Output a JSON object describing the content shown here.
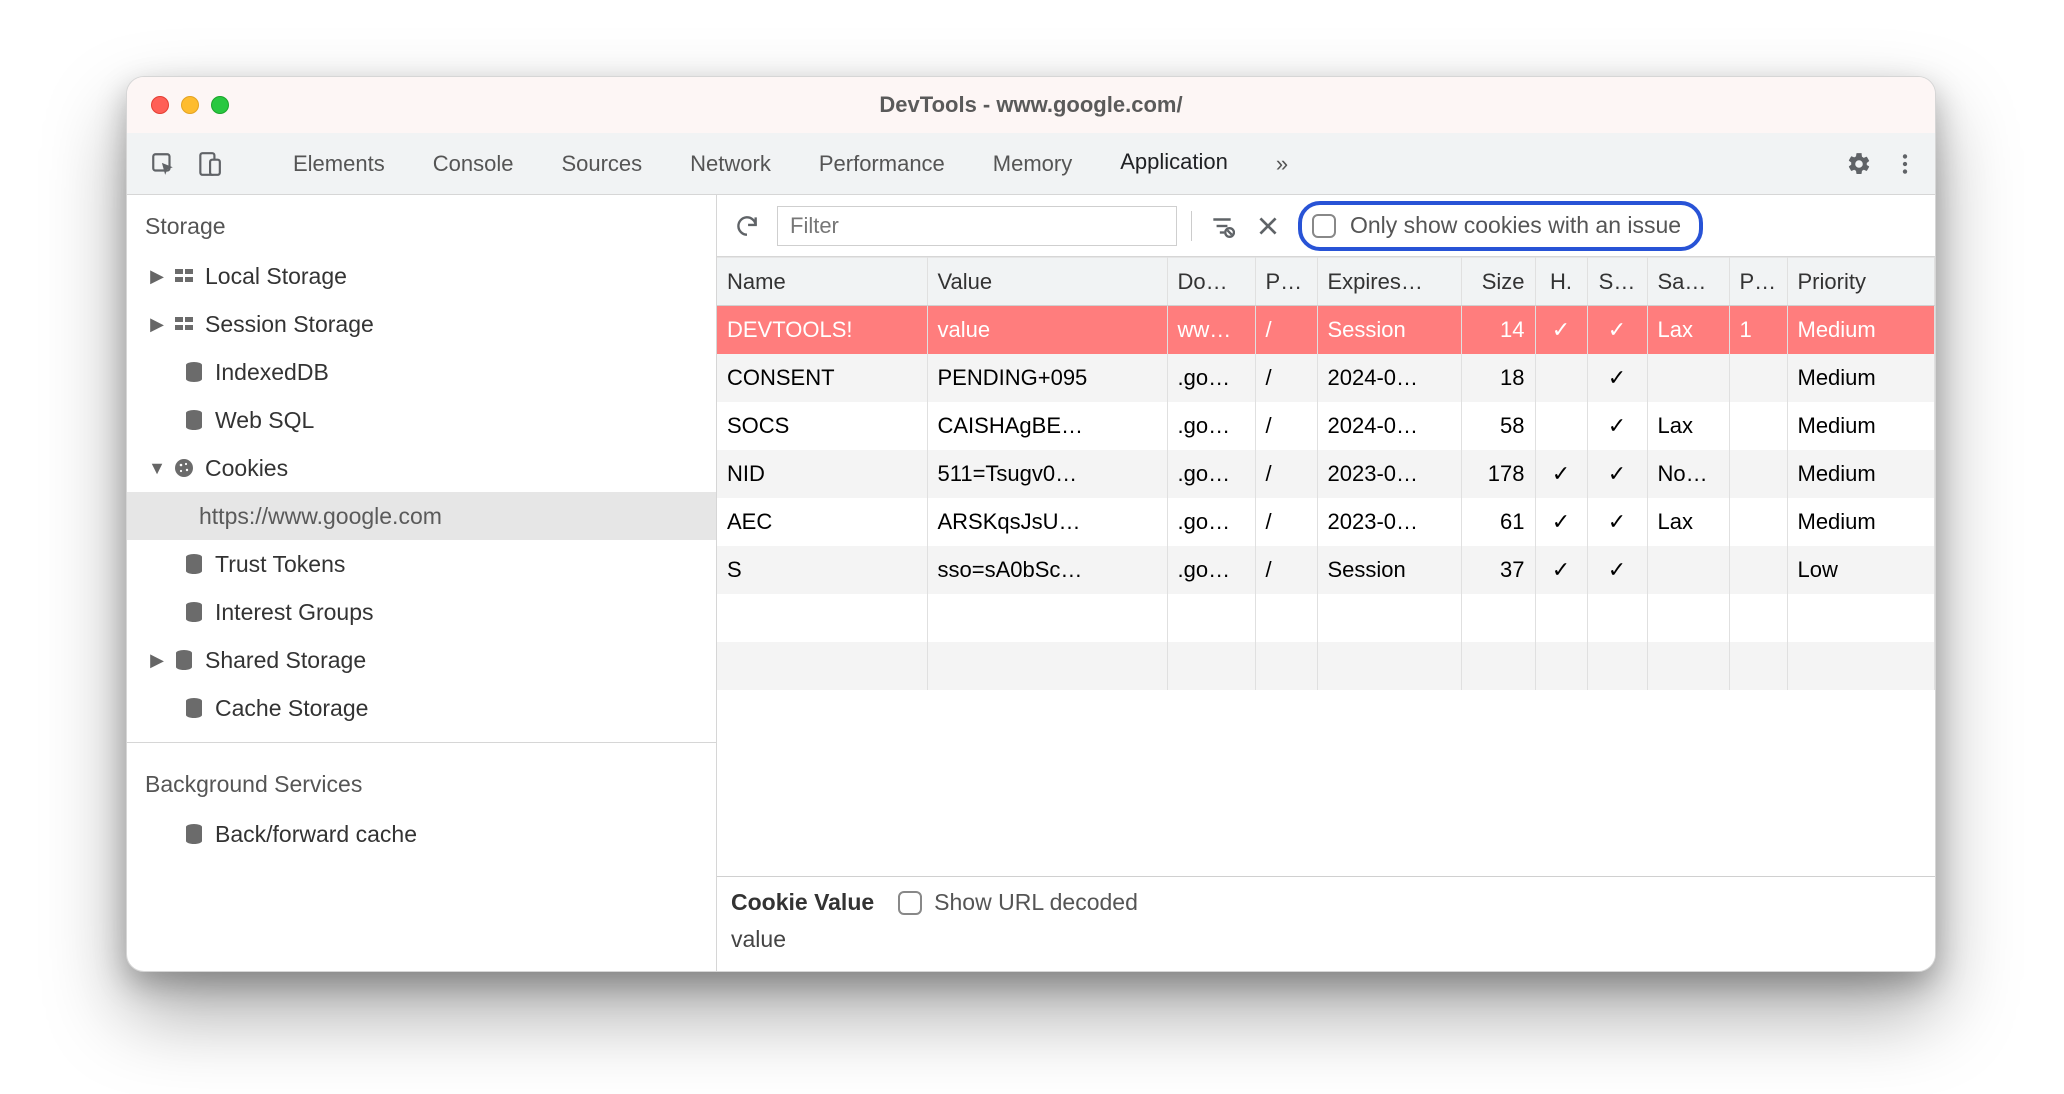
{
  "window": {
    "title": "DevTools - www.google.com/"
  },
  "toolbar": {
    "tabs": [
      "Elements",
      "Console",
      "Sources",
      "Network",
      "Performance",
      "Memory",
      "Application"
    ],
    "active_tab": "Application",
    "more": "»"
  },
  "filterbar": {
    "filter_placeholder": "Filter",
    "only_issues_label": "Only show cookies with an issue"
  },
  "sidebar": {
    "storage_title": "Storage",
    "items": [
      {
        "label": "Local Storage",
        "expandable": true
      },
      {
        "label": "Session Storage",
        "expandable": true
      },
      {
        "label": "IndexedDB",
        "expandable": false
      },
      {
        "label": "Web SQL",
        "expandable": false
      },
      {
        "label": "Cookies",
        "expandable": true,
        "expanded": true,
        "children": [
          {
            "label": "https://www.google.com",
            "selected": true
          }
        ]
      },
      {
        "label": "Trust Tokens",
        "expandable": false
      },
      {
        "label": "Interest Groups",
        "expandable": false
      },
      {
        "label": "Shared Storage",
        "expandable": true
      },
      {
        "label": "Cache Storage",
        "expandable": false
      }
    ],
    "bg_title": "Background Services",
    "bg_items": [
      {
        "label": "Back/forward cache"
      }
    ]
  },
  "table": {
    "headers": [
      "Name",
      "Value",
      "Do…",
      "P…",
      "Expires…",
      "Size",
      "H.",
      "S…",
      "Sa…",
      "P…",
      "Priority"
    ],
    "rows": [
      {
        "highlight": true,
        "name": "DEVTOOLS!",
        "value": "value",
        "domain": "ww…",
        "path": "/",
        "expires": "Session",
        "size": "14",
        "http": "✓",
        "secure": "✓",
        "samesite": "Lax",
        "partition": "1",
        "priority": "Medium"
      },
      {
        "highlight": false,
        "name": "CONSENT",
        "value": "PENDING+095",
        "domain": ".go…",
        "path": "/",
        "expires": "2024-0…",
        "size": "18",
        "http": "",
        "secure": "✓",
        "samesite": "",
        "partition": "",
        "priority": "Medium"
      },
      {
        "highlight": false,
        "name": "SOCS",
        "value": "CAISHAgBE…",
        "domain": ".go…",
        "path": "/",
        "expires": "2024-0…",
        "size": "58",
        "http": "",
        "secure": "✓",
        "samesite": "Lax",
        "partition": "",
        "priority": "Medium"
      },
      {
        "highlight": false,
        "name": "NID",
        "value": "511=Tsugv0…",
        "domain": ".go…",
        "path": "/",
        "expires": "2023-0…",
        "size": "178",
        "http": "✓",
        "secure": "✓",
        "samesite": "No…",
        "partition": "",
        "priority": "Medium"
      },
      {
        "highlight": false,
        "name": "AEC",
        "value": "ARSKqsJsU…",
        "domain": ".go…",
        "path": "/",
        "expires": "2023-0…",
        "size": "61",
        "http": "✓",
        "secure": "✓",
        "samesite": "Lax",
        "partition": "",
        "priority": "Medium"
      },
      {
        "highlight": false,
        "name": "S",
        "value": "sso=sA0bSc…",
        "domain": ".go…",
        "path": "/",
        "expires": "Session",
        "size": "37",
        "http": "✓",
        "secure": "✓",
        "samesite": "",
        "partition": "",
        "priority": "Low"
      }
    ]
  },
  "cookie_detail": {
    "label": "Cookie Value",
    "show_decoded_label": "Show URL decoded",
    "value": "value"
  }
}
